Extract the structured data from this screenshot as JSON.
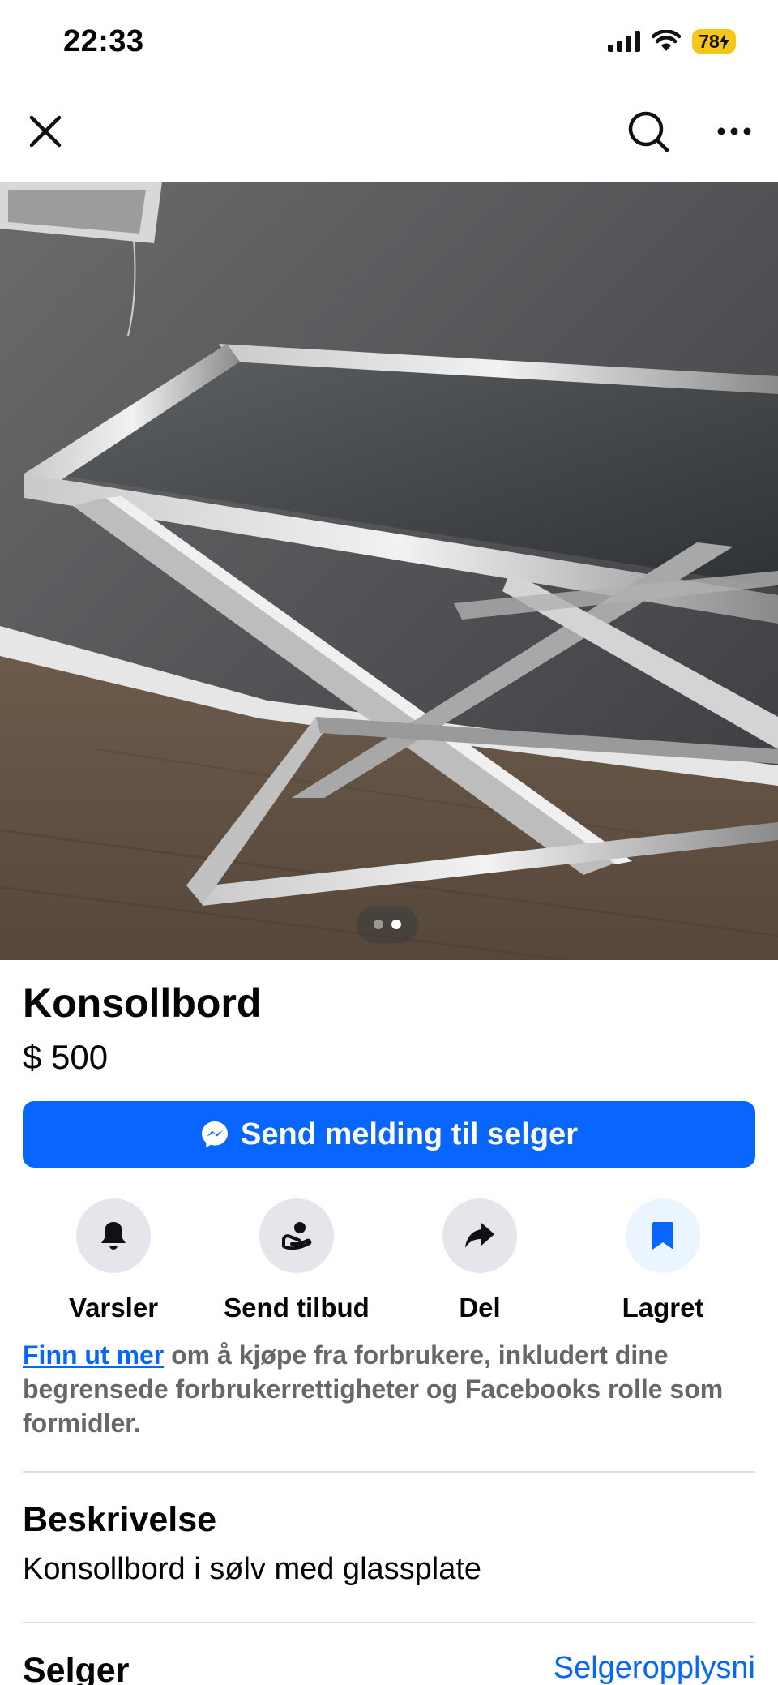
{
  "status": {
    "time": "22:33",
    "battery": "78"
  },
  "listing": {
    "title": "Konsollbord",
    "price": "$ 500",
    "photo_count": 2,
    "active_photo": 2
  },
  "primary_action": {
    "label": "Send melding til selger",
    "icon": "messenger-icon"
  },
  "actions": [
    {
      "label": "Varsler",
      "icon": "bell-icon"
    },
    {
      "label": "Send tilbud",
      "icon": "offer-hand-icon"
    },
    {
      "label": "Del",
      "icon": "share-arrow-icon"
    },
    {
      "label": "Lagret",
      "icon": "bookmark-icon"
    }
  ],
  "info": {
    "link_text": "Finn ut mer",
    "text": " om å kjøpe fra forbrukere, inkludert dine begrensede forbrukerrettigheter og Facebooks rolle som formidler."
  },
  "description": {
    "title": "Beskrivelse",
    "text": "Konsollbord i sølv med glassplate"
  },
  "seller": {
    "title": "Selger",
    "link": "Selgeropplysni"
  },
  "colors": {
    "accent": "#0866ff",
    "battery": "#f5c518",
    "icon_bg": "#e4e6eb",
    "saved_bg": "#ebf5ff"
  }
}
